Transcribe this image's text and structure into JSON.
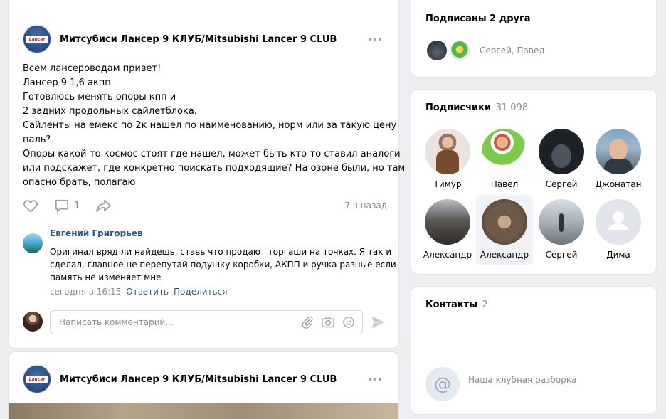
{
  "post1": {
    "group_name": "Митсубиси Лансер 9 КЛУБ/Mitsubishi Lancer 9 CLUB",
    "logo_text": "Lancer",
    "text_lines": [
      "Всем лансероводам привет!",
      "Лансер 9 1,6 акпп",
      "Готовлюсь менять опоры кпп и",
      "2 задних продольных сайлетблока.",
      "Сайленты на емекс по 2к нашел по наименованию, норм или за такую цену",
      "паль?",
      "Опоры какой-то космос стоят где нашел, может быть кто-то ставил аналоги",
      "или подскажет, где конкретно поискать подходящие? На озоне были, но там",
      "опасно брать, полагаю"
    ],
    "comment_count": "1",
    "time_ago": "7 ч назад",
    "comment": {
      "author": "Евгений Григорьев",
      "text_lines": [
        "Оригинал вряд ли найдешь, ставь что продают торгаши на точках. Я так и",
        "сделал, главное не перепутай подушку коробки, АКПП и ручка разные если",
        "память не изменяет мне"
      ],
      "date": "сегодня в 16:15",
      "reply": "Ответить",
      "share": "Поделиться"
    },
    "comment_input_placeholder": "Написать комментарий..."
  },
  "post2": {
    "group_name": "Митсубиси Лансер 9 КЛУБ/Mitsubishi Lancer 9 CLUB",
    "logo_text": "Lancer"
  },
  "friends": {
    "title": "Подписаны 2 друга",
    "names": "Сергей, Павел"
  },
  "subscribers": {
    "title": "Подписчики",
    "count": "31 098",
    "people": [
      {
        "name": "Тимур"
      },
      {
        "name": "Павел"
      },
      {
        "name": "Сергей"
      },
      {
        "name": "Джонатан"
      },
      {
        "name": "Александр"
      },
      {
        "name": "Александр"
      },
      {
        "name": "Сергей"
      },
      {
        "name": "Дима"
      }
    ]
  },
  "contacts": {
    "title": "Контакты",
    "count": "2",
    "item_name": "Наша клубная разборка"
  },
  "colors": {
    "link": "#2a5885",
    "muted": "#818c99",
    "background": "#edeef0"
  }
}
